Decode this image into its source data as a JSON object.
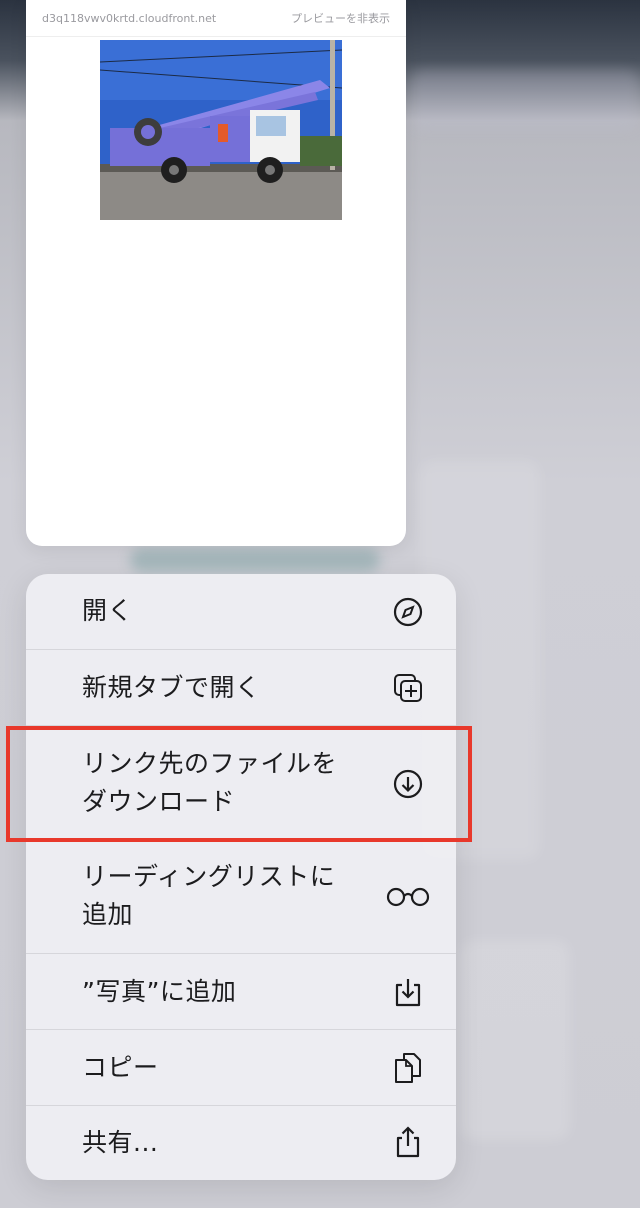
{
  "preview": {
    "host": "d3q118vwv0krtd.cloudfront.net",
    "hide_preview_label": "プレビューを非表示",
    "image_alt": "blue aerial work platform truck"
  },
  "menu": {
    "items": [
      {
        "label": "開く",
        "icon": "compass-icon"
      },
      {
        "label": "新規タブで開く",
        "icon": "new-tab-icon"
      },
      {
        "label_lines": [
          "リンク先のファイルを",
          "ダウンロード"
        ],
        "icon": "download-circle-icon"
      },
      {
        "label_lines": [
          "リーディングリストに",
          "追加"
        ],
        "icon": "glasses-icon"
      },
      {
        "label": "”写真”に追加",
        "icon": "save-to-photos-icon"
      },
      {
        "label": "コピー",
        "icon": "copy-icon"
      },
      {
        "label": "共有...",
        "icon": "share-icon"
      }
    ]
  },
  "highlight": {
    "color": "#e8382b",
    "target": "download-linked-file"
  }
}
